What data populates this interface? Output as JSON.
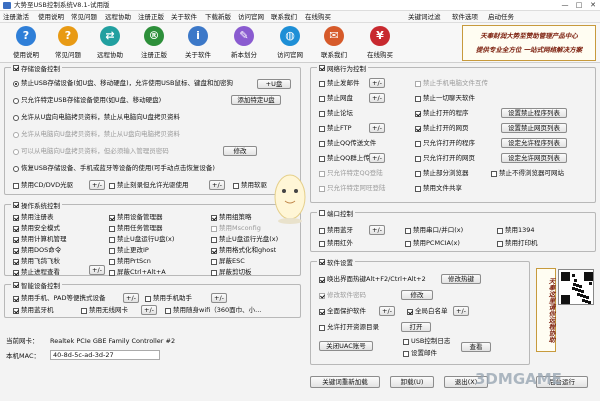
{
  "window": {
    "title": "大势至USB控制系统V8.1-试用版",
    "min": "—",
    "max": "□",
    "close": "✕"
  },
  "menu": [
    "注册激活",
    "使用说明",
    "常见问题",
    "远程协助",
    "注册正版",
    "关于软件",
    "下载新版",
    "访问官网",
    "联系我们",
    "在线购买",
    "关键词过滤",
    "软件选项",
    "启动任务"
  ],
  "toolbar": [
    {
      "label": "使用说明",
      "icon": "book-icon",
      "glyph": "?",
      "color": "#2f7fd8"
    },
    {
      "label": "常见问题",
      "icon": "question-icon",
      "glyph": "?",
      "color": "#e89a14"
    },
    {
      "label": "远程协助",
      "icon": "remote-icon",
      "glyph": "⇄",
      "color": "#22a0a0"
    },
    {
      "label": "注册正版",
      "icon": "register-icon",
      "glyph": "®",
      "color": "#2d8f3a"
    },
    {
      "label": "关于软件",
      "icon": "info-icon",
      "glyph": "i",
      "color": "#3c78c8"
    },
    {
      "label": "新本划分",
      "icon": "tools-icon",
      "glyph": "✎",
      "color": "#8a5bd0"
    },
    {
      "label": "访问官网",
      "icon": "globe-icon",
      "glyph": "◍",
      "color": "#1e8fd6"
    },
    {
      "label": "联系我们",
      "icon": "contact-icon",
      "glyph": "✉",
      "color": "#d65a2a"
    },
    {
      "label": "在线购买",
      "icon": "cart-icon",
      "glyph": "¥",
      "color": "#c8292f"
    }
  ],
  "banner": {
    "line1": "天奉财润大势至赞助管理产品中心",
    "line2": "提供专业全方位  一站式网络解决方案"
  },
  "usb": {
    "title": "存储设备控制",
    "r1": "禁止USB存储设备(如U盘、移动硬盘)，允许使用USB鼠标、键盘和加密狗",
    "r1btn": "+U盘",
    "r2": "只允许特定USB存储设备使用(如U盘、移动硬盘)",
    "r2btn": "添加特定U盘",
    "r3": "允许从U盘向电脑拷贝资料，禁止从电脑向U盘拷贝资料",
    "r4": "允许从电脑向U盘拷贝资料，禁止从U盘向电脑拷贝资料",
    "r5": "可以从电脑向U盘拷贝资料，但必须输入管理员密码",
    "r5btn": "修改",
    "r6": "恢复USB存储设备、手机或蓝牙等设备的使用(可手动点击恢复设备)",
    "cd1": "禁用CD/DVD光驱",
    "cd2": "禁止刻录但允许光驱使用",
    "cd3": "禁用软驱",
    "plus": "+/-"
  },
  "sys": {
    "title": "操作系统控制",
    "items": [
      "禁用注册表",
      "禁用设备管理器",
      "禁用组策略",
      "禁用安全模式",
      "禁用任务管理器",
      "禁用Msconfig",
      "禁用计算机管理",
      "禁止U盘运行U盘(x)",
      "禁止U盘运行光盘(x)",
      "禁用DOS命令",
      "禁止更改IP",
      "禁用格式化和ghost",
      "禁用飞鸽飞秋",
      "禁用PrtScn",
      "屏蔽ESC",
      "禁止进程查看",
      "屏蔽Ctrl+Alt+A",
      "屏蔽剪切板"
    ],
    "plus": "+/-"
  },
  "smart": {
    "title": "智能设备控制",
    "i1": "禁用手机、PAD等便携式设备",
    "i2": "禁用手机助手",
    "i3": "禁用蓝牙机",
    "i4": "禁用无线网卡",
    "i5": "禁用随身wifi（360面巾、小...",
    "plus": "+/-"
  },
  "nic": {
    "label": "当前网卡：",
    "value": "Realtek PCIe GBE Family Controller #2"
  },
  "mac": {
    "label": "本机MAC：",
    "value": "40-8d-5c-ad-3d-27"
  },
  "net": {
    "title": "网络行为控制",
    "items": [
      "禁止发邮件",
      "禁止手机电脑文件互传",
      "禁止网盘",
      "禁止一切聊天软件",
      "禁止论坛",
      "禁止打开的程序",
      "禁止FTP",
      "禁止打开的网页",
      "禁止QQ传送文件",
      "只允许打开的程序",
      "禁止QQ群上传文件",
      "只允许打开的网页",
      "只允许特定QQ登陆",
      "禁止部分浏览器",
      "禁止不得浏览器可网站",
      "只允许特定阿旺登陆",
      "禁用文件共享"
    ],
    "b1": "设置禁止程序列表",
    "b2": "设置禁止网页列表",
    "b3": "设定允许程序列表",
    "b4": "设定允许网页列表",
    "plus": "+/-"
  },
  "port": {
    "title": "端口控制",
    "items": [
      "禁用蓝牙",
      "禁用串口/并口(x)",
      "禁用1394",
      "禁用红外",
      "禁用PCMCIA(x)",
      "禁用打印机"
    ],
    "plus": "+/-"
  },
  "soft": {
    "title": "软件设置",
    "i1": "唤出界面热键Alt+F2/Ctrl+Alt+2",
    "b1": "修改热键",
    "i2": "修改软件密码",
    "b2": "修改",
    "i3": "全面保护软件",
    "i4": "全局白名单",
    "i5": "允许打开资源目录",
    "b3": "打开",
    "b4": "关闭UAC账号",
    "i6": "USB控制日志",
    "i7": "设置邮件",
    "b5": "查看",
    "plus": "+/-"
  },
  "calendar": {
    "text": "天奉这里请你远程协助"
  },
  "bottom": {
    "b1": "关键词重新加载",
    "b2": "卸载(U)",
    "b3": "退出(X)",
    "b4": "后台运行"
  },
  "watermark": "3DMGAME"
}
